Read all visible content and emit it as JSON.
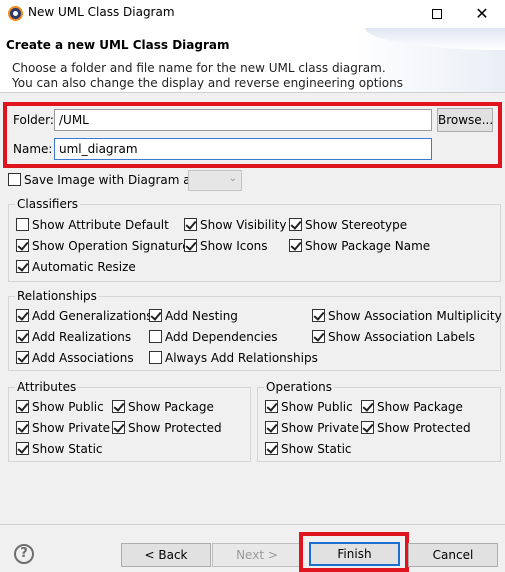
{
  "window": {
    "title": "New UML Class Diagram",
    "maximize_icon": "maximize-icon",
    "close_glyph": "✕"
  },
  "banner": {
    "title": "Create a new UML Class Diagram",
    "desc_line1": "Choose a folder and file name for the new UML class diagram.",
    "desc_line2": "You can also change the display and reverse engineering options"
  },
  "form": {
    "folder_label": "Folder:",
    "folder_value": "/UML",
    "browse_label": "Browse...",
    "name_label": "Name:",
    "name_value": "uml_diagram",
    "save_image_label": "Save Image with Diagram as",
    "save_image_checked": false,
    "format_value": ""
  },
  "classifiers": {
    "title": "Classifiers",
    "items": [
      {
        "label": "Show Attribute Default",
        "checked": false
      },
      {
        "label": "Show Visibility",
        "checked": true
      },
      {
        "label": "Show Stereotype",
        "checked": true
      },
      {
        "label": "Show Operation Signature",
        "checked": true
      },
      {
        "label": "Show Icons",
        "checked": true
      },
      {
        "label": "Show Package Name",
        "checked": true
      },
      {
        "label": "Automatic Resize",
        "checked": true
      }
    ]
  },
  "relationships": {
    "title": "Relationships",
    "items": [
      {
        "label": "Add Generalizations",
        "checked": true
      },
      {
        "label": "Add Nesting",
        "checked": true
      },
      {
        "label": "Show Association Multiplicity",
        "checked": true
      },
      {
        "label": "Add Realizations",
        "checked": true
      },
      {
        "label": "Add Dependencies",
        "checked": false
      },
      {
        "label": "Show Association Labels",
        "checked": true
      },
      {
        "label": "Add Associations",
        "checked": true
      },
      {
        "label": "Always Add Relationships",
        "checked": false
      }
    ]
  },
  "attributes": {
    "title": "Attributes",
    "items": [
      {
        "label": "Show Public",
        "checked": true
      },
      {
        "label": "Show Package",
        "checked": true
      },
      {
        "label": "Show Private",
        "checked": true
      },
      {
        "label": "Show Protected",
        "checked": true
      },
      {
        "label": "Show Static",
        "checked": true
      }
    ]
  },
  "operations": {
    "title": "Operations",
    "items": [
      {
        "label": "Show Public",
        "checked": true
      },
      {
        "label": "Show Package",
        "checked": true
      },
      {
        "label": "Show Private",
        "checked": true
      },
      {
        "label": "Show Protected",
        "checked": true
      },
      {
        "label": "Show Static",
        "checked": true
      }
    ]
  },
  "footer": {
    "help_glyph": "?",
    "back_label": "< Back",
    "next_label": "Next >",
    "finish_label": "Finish",
    "cancel_label": "Cancel"
  },
  "colors": {
    "highlight": "#e0141e",
    "focus": "#3d7bd0"
  }
}
